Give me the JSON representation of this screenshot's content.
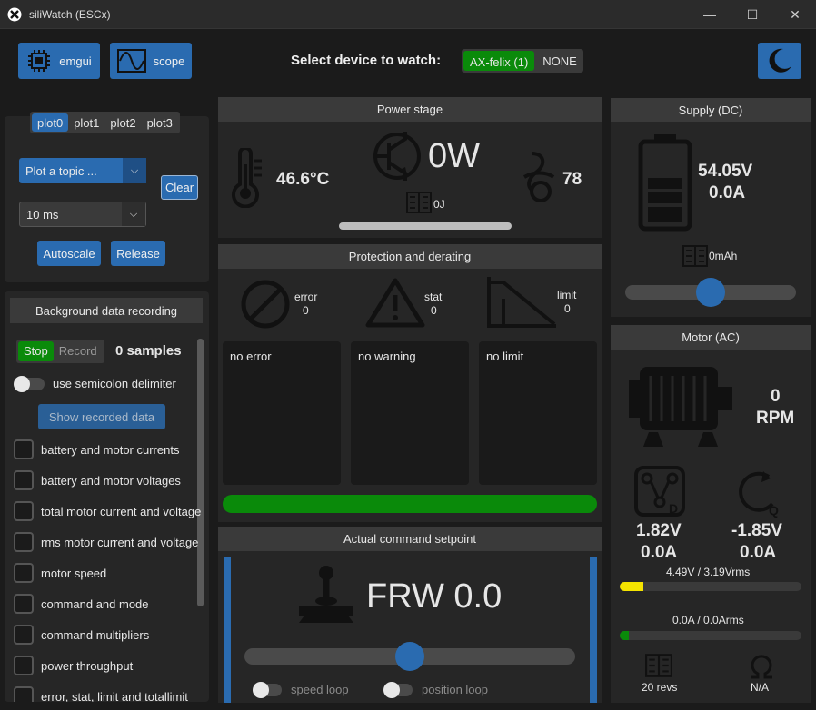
{
  "window": {
    "title": "siliWatch (ESCx)",
    "minimize": "—",
    "maximize": "☐",
    "close": "✕"
  },
  "toolbar": {
    "emgui_label": "emgui",
    "scope_label": "scope",
    "select_label": "Select device to watch:",
    "device_options": [
      "AX-felix (1)",
      "NONE"
    ],
    "selected_device": "AX-felix (1)"
  },
  "plot": {
    "tabs": [
      "plot0",
      "plot1",
      "plot2",
      "plot3"
    ],
    "active_tab": "plot0",
    "topic_combo": "Plot a topic ...",
    "clear_label": "Clear",
    "interval_combo": "10 ms",
    "autoscale_label": "Autoscale",
    "release_label": "Release"
  },
  "recording": {
    "header": "Background data recording",
    "stop_label": "Stop",
    "record_label": "Record",
    "samples": "0 samples",
    "semicolon_label": "use semicolon delimiter",
    "semicolon_on": false,
    "show_label": "Show recorded data",
    "items": [
      "battery and motor currents",
      "battery and motor voltages",
      "total motor current and voltage",
      "rms motor current and voltage",
      "motor speed",
      "command and mode",
      "command multipliers",
      "power throughput",
      "error, stat, limit and totallimit"
    ]
  },
  "power": {
    "header": "Power stage",
    "temperature": "46.6°C",
    "power": "0W",
    "fan": "78",
    "energy": "0J",
    "progress": 0.0
  },
  "protection": {
    "header": "Protection and derating",
    "error_label": "error",
    "error_count": "0",
    "stat_label": "stat",
    "stat_count": "0",
    "limit_label": "limit",
    "limit_count": "0",
    "error_text": "no error",
    "warning_text": "no warning",
    "limit_text": "no limit",
    "status_color": "#0a8a0a"
  },
  "command": {
    "header": "Actual command setpoint",
    "value": "FRW 0.0",
    "setpoint_fraction": 0.5,
    "speed_loop_label": "speed loop",
    "position_loop_label": "position loop"
  },
  "supply": {
    "header": "Supply (DC)",
    "voltage": "54.05V",
    "current": "0.0A",
    "charge": "0mAh",
    "slider_fraction": 0.5
  },
  "motor": {
    "header": "Motor (AC)",
    "speed": "0",
    "speed_unit": "RPM",
    "d_voltage": "1.82V",
    "d_current": "0.0A",
    "q_voltage": "-1.85V",
    "q_current": "0.0A",
    "voltage_rms": "4.49V / 3.19Vrms",
    "voltage_fraction": 0.13,
    "current_rms": "0.0A / 0.0Arms",
    "current_fraction": 0.05,
    "revs": "20 revs",
    "resistance": "N/A"
  },
  "colors": {
    "accent": "#2a6bb0",
    "active_green": "#0a8a0a",
    "voltage_bar": "#f5e400"
  }
}
